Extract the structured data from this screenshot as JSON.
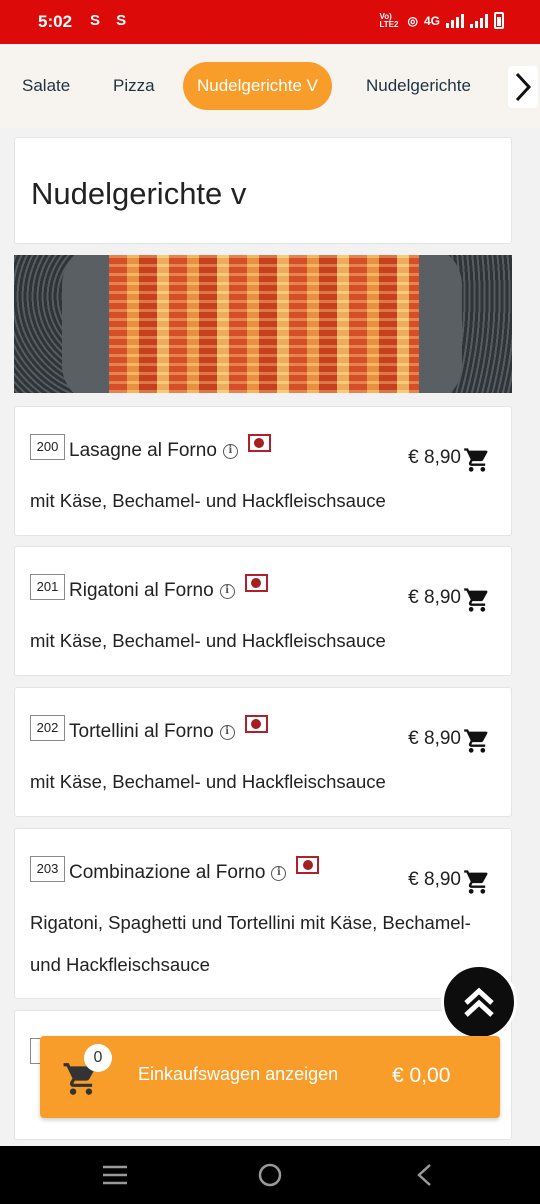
{
  "status_bar": {
    "time": "5:02",
    "left_icons": "S S",
    "network": "Vo) LTE2",
    "network_type": "4G"
  },
  "tabs": [
    {
      "label": "Salate"
    },
    {
      "label": "Pizza"
    },
    {
      "label": "Nudelgerichte V"
    },
    {
      "label": "Nudelgerichte"
    }
  ],
  "section": {
    "title": "Nudelgerichte v"
  },
  "items": [
    {
      "number": "200",
      "name": "Lasagne al Forno",
      "price": "€ 8,90",
      "description": "mit Käse, Bechamel- und Hackfleischsauce"
    },
    {
      "number": "201",
      "name": "Rigatoni al Forno",
      "price": "€ 8,90",
      "description": "mit Käse, Bechamel- und Hackfleischsauce"
    },
    {
      "number": "202",
      "name": "Tortellini al Forno",
      "price": "€ 8,90",
      "description": "mit Käse, Bechamel- und Hackfleischsauce"
    },
    {
      "number": "203",
      "name": "Combinazione al Forno",
      "price": "€ 8,90",
      "description": "Rigatoni, Spaghetti und Tortellini mit Käse, Bechamel- und Hackfleischsauce"
    }
  ],
  "cart": {
    "count": "0",
    "label": "Einkaufswagen anzeigen",
    "total": "€ 0,00"
  },
  "colors": {
    "accent": "#f89d2a",
    "status_bar": "#dd0a0a"
  }
}
